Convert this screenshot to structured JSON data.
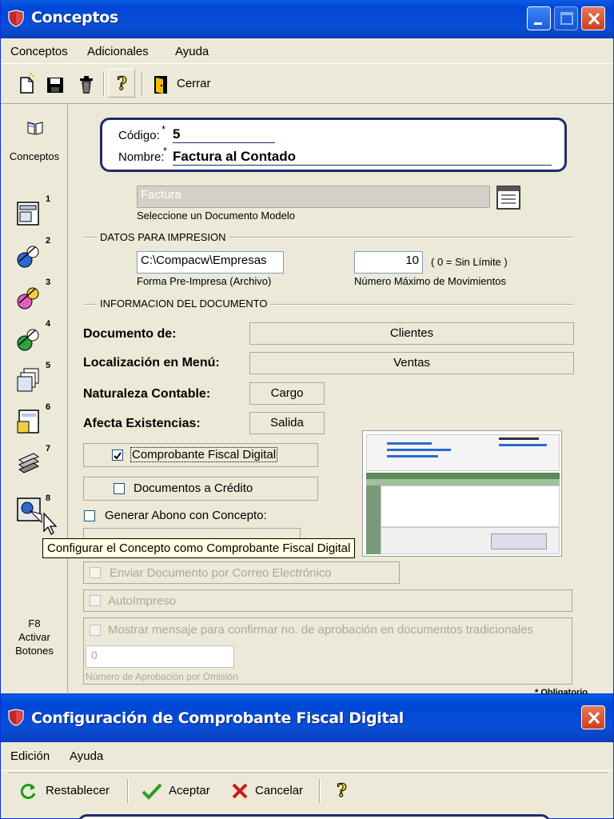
{
  "window1": {
    "title": "Conceptos",
    "menu": [
      "Conceptos",
      "Adicionales",
      "Ayuda"
    ],
    "toolbar": {
      "close_label": "Cerrar"
    },
    "leftnav": {
      "header_label": "Conceptos",
      "buttons": [
        "1",
        "2",
        "3",
        "4",
        "5",
        "6",
        "7",
        "8"
      ],
      "footer": [
        "F8",
        "Activar",
        "Botones"
      ]
    },
    "header_card": {
      "codigo_label": "Código:",
      "codigo_value": "5",
      "nombre_label": "Nombre:",
      "nombre_value": "Factura al Contado",
      "required_mark": "*"
    },
    "document_model": {
      "value": "Factura",
      "caption": "Seleccione un Documento Modelo"
    },
    "datos_impresion": {
      "title": "DATOS PARA IMPRESION",
      "forma_value": "C:\\Compacw\\Empresas",
      "forma_caption": "Forma Pre-Impresa (Archivo)",
      "max_mov_value": "10",
      "max_mov_hint": "( 0 = Sin Límite )",
      "max_mov_caption": "Número Máximo de Movimientos"
    },
    "info_documento": {
      "title": "INFORMACION  DEL DOCUMENTO",
      "documento_de_label": "Documento de:",
      "documento_de_value": "Clientes",
      "localizacion_label": "Localización en Menú:",
      "localizacion_value": "Ventas",
      "naturaleza_label": "Naturaleza Contable:",
      "naturaleza_value": "Cargo",
      "afecta_label": "Afecta Existencias:",
      "afecta_value": "Salida"
    },
    "options": {
      "cfd_label": "Comprobante Fiscal Digital",
      "cfd_checked": true,
      "credito_label": "Documentos a Crédito",
      "credito_checked": false,
      "abono_label": "Generar Abono con Concepto:",
      "enviar_label": "Enviar Documento por Correo Electrónico",
      "autoimpreso_label": "AutoImpreso",
      "mostrar_label": "Mostrar mensaje para confirmar no. de aprobación en documentos tradicionales",
      "aprobacion_value": "0",
      "aprobacion_caption": "Número de Aprobación por Omisión"
    },
    "tooltip": "Configurar el Concepto como Comprobante Fiscal Digital",
    "footnote": "* Obligatorio"
  },
  "window2": {
    "title": "Configuración de Comprobante Fiscal Digital",
    "menu": [
      "Edición",
      "Ayuda"
    ],
    "toolbar": {
      "reset_label": "Restablecer",
      "accept_label": "Aceptar",
      "cancel_label": "Cancelar"
    }
  },
  "colors": {
    "titlebar": "#0a4ed6",
    "face": "#ece9d8",
    "card_border": "#1f2a6b",
    "close_button": "#c9401c"
  }
}
